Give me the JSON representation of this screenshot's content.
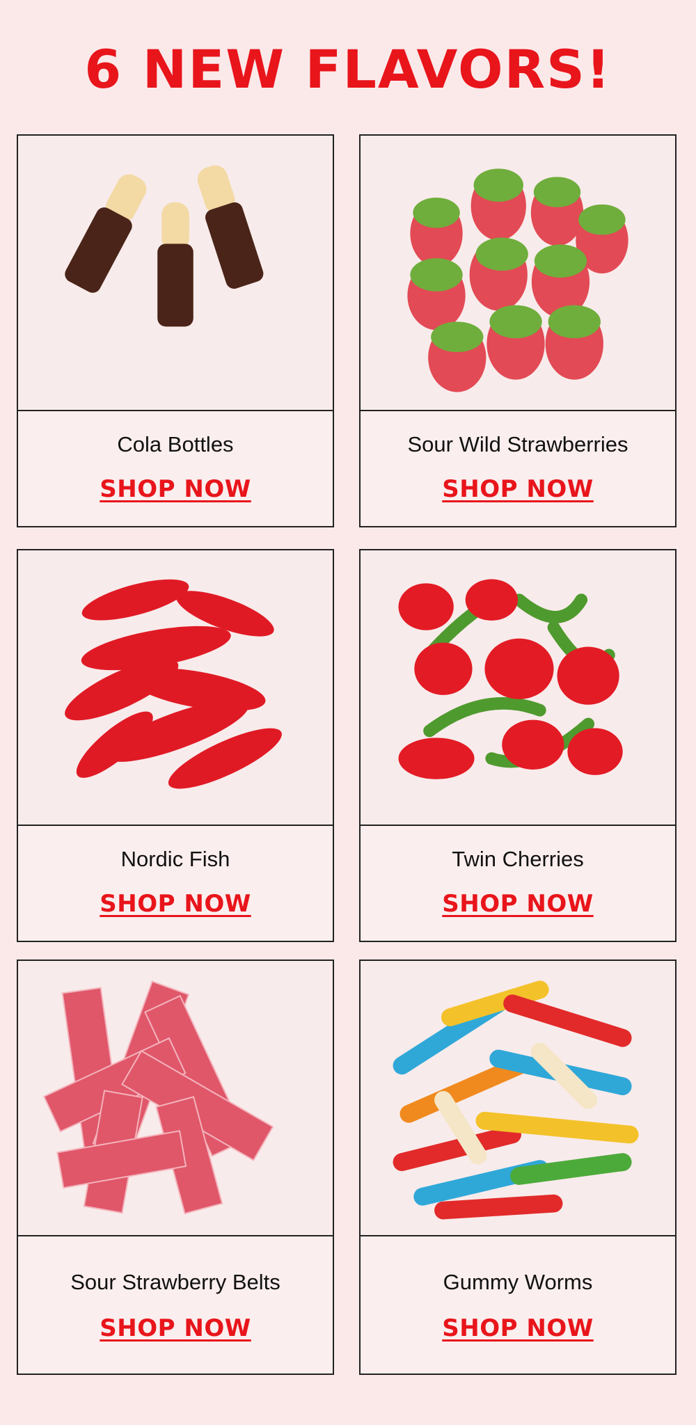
{
  "title": "6 NEW FLAVORS!",
  "products": [
    {
      "name": "Cola Bottles",
      "cta": "SHOP NOW",
      "icon": "cola-bottles-candy-image"
    },
    {
      "name": "Sour Wild Strawberries",
      "cta": "SHOP NOW",
      "icon": "sour-strawberries-candy-image"
    },
    {
      "name": "Nordic Fish",
      "cta": "SHOP NOW",
      "icon": "nordic-fish-candy-image"
    },
    {
      "name": "Twin Cherries",
      "cta": "SHOP NOW",
      "icon": "twin-cherries-candy-image"
    },
    {
      "name": "Sour Strawberry Belts",
      "cta": "SHOP NOW",
      "icon": "strawberry-belts-candy-image"
    },
    {
      "name": "Gummy Worms",
      "cta": "SHOP NOW",
      "icon": "gummy-worms-candy-image"
    }
  ],
  "colors": {
    "accent": "#e8151b",
    "background": "#fbe9ea",
    "border": "#222222"
  }
}
